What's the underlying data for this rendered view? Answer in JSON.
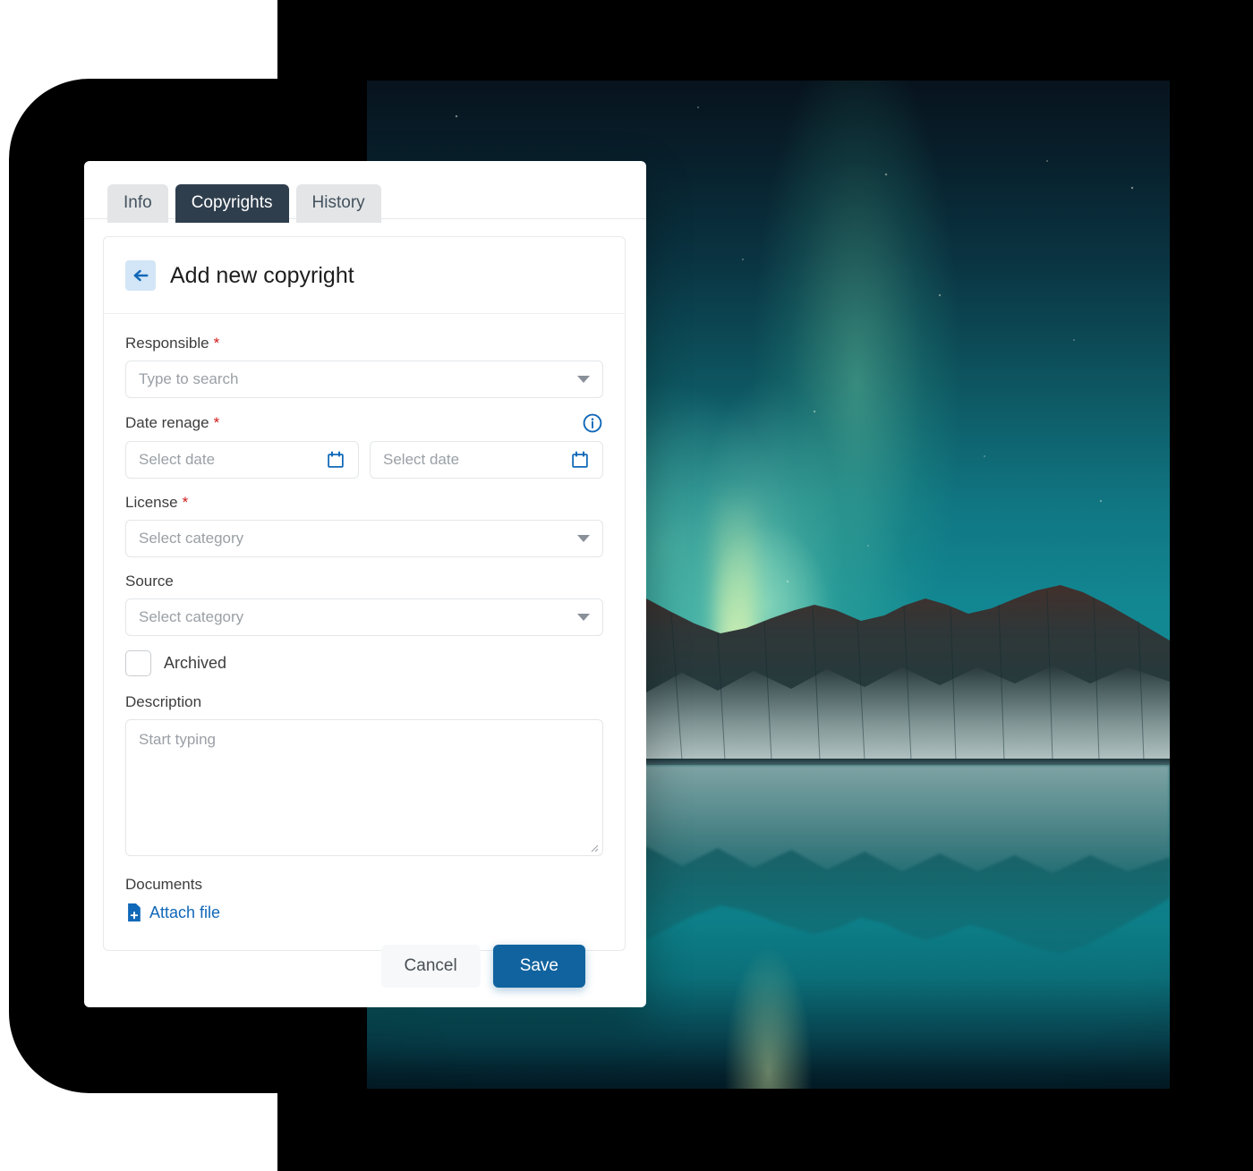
{
  "window": {
    "tabs": [
      {
        "label": "Info",
        "active": false
      },
      {
        "label": "Copyrights",
        "active": true
      },
      {
        "label": "History",
        "active": false
      }
    ]
  },
  "panel": {
    "back_icon": "arrow-left-icon",
    "title": "Add new copyright"
  },
  "form": {
    "responsible": {
      "label": "Responsible",
      "required_mark": "*",
      "placeholder": "Type to search",
      "icon": "chevron-down-icon"
    },
    "date_range": {
      "label": "Date renage",
      "required_mark": "*",
      "info_icon": "info-circle-icon",
      "start_placeholder": "Select date",
      "end_placeholder": "Select date",
      "calendar_icon": "calendar-icon"
    },
    "license": {
      "label": "License",
      "required_mark": "*",
      "placeholder": "Select category",
      "icon": "chevron-down-icon"
    },
    "source": {
      "label": "Source",
      "placeholder": "Select category",
      "icon": "chevron-down-icon"
    },
    "archived": {
      "label": "Archived",
      "checked": false
    },
    "description": {
      "label": "Description",
      "placeholder": "Start typing",
      "value": ""
    },
    "documents": {
      "label": "Documents",
      "attach_label": "Attach file",
      "attach_icon": "file-add-icon"
    }
  },
  "footer": {
    "cancel_label": "Cancel",
    "save_label": "Save"
  },
  "colors": {
    "accent_blue": "#11639f",
    "link_blue": "#1068b8",
    "tab_active_bg": "#2f3e4d",
    "tab_inactive_bg": "#e3e5e7",
    "required_red": "#d01919",
    "back_btn_bg": "#d3e6f7"
  },
  "background": {
    "description": "aurora-over-mountains-photo"
  }
}
